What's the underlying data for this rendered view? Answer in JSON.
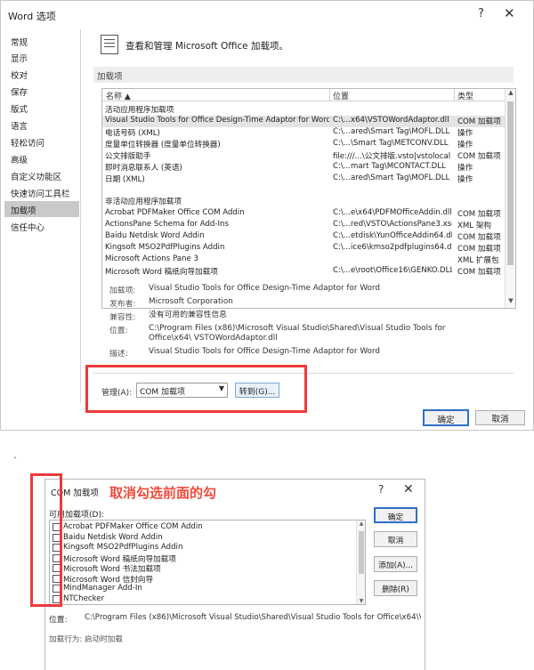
{
  "dialog1": {
    "title": "Word 选项",
    "help": "?",
    "close": "✕",
    "nav": [
      "常规",
      "显示",
      "校对",
      "保存",
      "版式",
      "语言",
      "轻松访问",
      "高级",
      "自定义功能区",
      "快速访问工具栏",
      "加载项",
      "信任中心"
    ],
    "header": "查看和管理 Microsoft Office 加载项。",
    "section": "加载项",
    "columns": {
      "name": "名称 ▲",
      "location": "位置",
      "type": "类型"
    },
    "active_group": "活动应用程序加载项",
    "active_rows": [
      {
        "name": "Visual Studio Tools for Office Design-Time Adaptor for Word",
        "location": "C:\\...x64\\VSTOWordAdaptor.dll",
        "type": "COM 加载项"
      },
      {
        "name": "电话号码 (XML)",
        "location": "C:\\...ared\\Smart Tag\\MOFL.DLL",
        "type": "操作"
      },
      {
        "name": "度量单位转换器 (度量单位转换器)",
        "location": "C:\\...\\Smart Tag\\METCONV.DLL",
        "type": "操作"
      },
      {
        "name": "公文排版助手",
        "location": "file:///...\\公文排版.vsto|vstolocal",
        "type": "COM 加载项"
      },
      {
        "name": "即时消息联系人 (英语)",
        "location": "C:\\...mart Tag\\MCONTACT.DLL",
        "type": "操作"
      },
      {
        "name": "日期 (XML)",
        "location": "C:\\...ared\\Smart Tag\\MOFL.DLL",
        "type": "操作"
      }
    ],
    "inactive_group": "非活动应用程序加载项",
    "inactive_rows": [
      {
        "name": "Acrobat PDFMaker Office COM Addin",
        "location": "C:\\...e\\x64\\PDFMOfficeAddin.dll",
        "type": "COM 加载项"
      },
      {
        "name": "ActionsPane Schema for Add-Ins",
        "location": "C:\\...red\\VSTO\\ActionsPane3.xsd",
        "type": "XML 架构"
      },
      {
        "name": "Baidu Netdisk Word Addin",
        "location": "C:\\...etdisk\\YunOfficeAddin64.dll",
        "type": "COM 加载项"
      },
      {
        "name": "Kingsoft MSO2PdfPlugins Addin",
        "location": "C:\\...ice6\\kmso2pdfplugins64.dll",
        "type": "COM 加载项"
      },
      {
        "name": "Microsoft Actions Pane 3",
        "location": "",
        "type": "XML 扩展包"
      },
      {
        "name": "Microsoft Word 稿纸向导加载项",
        "location": "C:\\...e\\root\\Office16\\GENKO.DLL",
        "type": "COM 加载项"
      }
    ],
    "details": [
      {
        "label": "加载项:",
        "value": "Visual Studio Tools for Office Design-Time Adaptor for Word"
      },
      {
        "label": "发布者:",
        "value": "Microsoft Corporation"
      },
      {
        "label": "兼容性:",
        "value": "没有可用的兼容性信息"
      },
      {
        "label": "位置:",
        "value": "C:\\Program Files (x86)\\Microsoft Visual Studio\\Shared\\Visual Studio Tools for Office\\x64\\ VSTOWordAdaptor.dll"
      },
      {
        "label": "描述:",
        "value": "Visual Studio Tools for Office Design-Time Adaptor for Word"
      }
    ],
    "manage_label": "管理(A):",
    "manage_value": "COM 加载项",
    "go_button": "转到(G)...",
    "ok": "确定",
    "cancel": "取消"
  },
  "separator_dot": ".",
  "dialog2": {
    "title": "COM 加载项",
    "help": "?",
    "close": "✕",
    "annotation": "取消勾选前面的勾",
    "available_label": "可用加载项(D):",
    "items": [
      "Acrobat PDFMaker Office COM Addin",
      "Baidu Netdisk Word Addin",
      "Kingsoft MSO2PdfPlugins Addin",
      "Microsoft Word 稿纸向导加载项",
      "Microsoft Word 书法加载项",
      "Microsoft Word 信封向导",
      "MindManager Add-In",
      "NTChecker"
    ],
    "buttons": {
      "ok": "确定",
      "cancel": "取消",
      "add": "添加(A)...",
      "remove": "删除(R)"
    },
    "location_label": "位置:",
    "location_value": "C:\\Program Files (x86)\\Microsoft Visual Studio\\Shared\\Visual Studio Tools for Office\\x64\\V...",
    "behavior_label": "加载行为:",
    "behavior_value": "启动时加载"
  },
  "colors": {
    "accent": "#2f6fc7",
    "annotation_red": "#ee3a3a",
    "selected_nav": "#c9c9c9"
  }
}
